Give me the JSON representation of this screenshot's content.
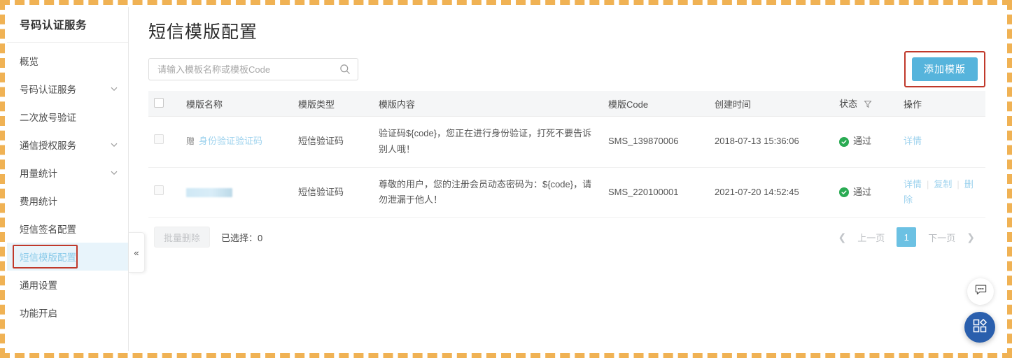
{
  "sidebar": {
    "title": "号码认证服务",
    "items": [
      {
        "label": "概览",
        "expandable": false,
        "active": false
      },
      {
        "label": "号码认证服务",
        "expandable": true,
        "active": false
      },
      {
        "label": "二次放号验证",
        "expandable": false,
        "active": false
      },
      {
        "label": "通信授权服务",
        "expandable": true,
        "active": false
      },
      {
        "label": "用量统计",
        "expandable": true,
        "active": false
      },
      {
        "label": "费用统计",
        "expandable": false,
        "active": false
      },
      {
        "label": "短信签名配置",
        "expandable": false,
        "active": false
      },
      {
        "label": "短信模版配置",
        "expandable": false,
        "active": true
      },
      {
        "label": "通用设置",
        "expandable": false,
        "active": false
      },
      {
        "label": "功能开启",
        "expandable": false,
        "active": false
      }
    ],
    "collapse_icon": "«"
  },
  "main": {
    "page_title": "短信模版配置",
    "search": {
      "value": "",
      "placeholder": "请输入模板名称或模板Code",
      "icon": "search-icon"
    },
    "add_button": {
      "label": "添加模版",
      "color": "#56b4dc"
    },
    "table": {
      "columns": [
        "",
        "模版名称",
        "模版类型",
        "模版内容",
        "模版Code",
        "创建时间",
        "状态",
        "操作"
      ],
      "status_filter_icon": "filter-icon",
      "rows": [
        {
          "checked": false,
          "tag": "赠",
          "name": "身份验证验证码",
          "name_redacted": false,
          "type": "短信验证码",
          "content": "验证码${code}，您正在进行身份验证，打死不要告诉别人哦！",
          "code": "SMS_139870006",
          "created_at": "2018-07-13 15:36:06",
          "status": "通过",
          "actions": [
            "详情"
          ]
        },
        {
          "checked": false,
          "tag": "",
          "name": "",
          "name_redacted": true,
          "type": "短信验证码",
          "content": "尊敬的用户，您的注册会员动态密码为：${code}，请勿泄漏于他人！",
          "code": "SMS_220100001",
          "created_at": "2021-07-20 14:52:45",
          "status": "通过",
          "actions": [
            "详情",
            "复制",
            "删除"
          ]
        }
      ]
    },
    "footer": {
      "bulk_delete_label": "批量删除",
      "selected_label": "已选择：",
      "selected_count": "0",
      "pagination": {
        "prev_arrow": "❮",
        "prev_label": "上一页",
        "current_page": "1",
        "next_label": "下一页",
        "next_arrow": "❯"
      }
    },
    "fabs": [
      {
        "name": "chat-bubble-icon"
      },
      {
        "name": "apps-grid-icon"
      }
    ]
  },
  "colors": {
    "accent": "#56b4dc",
    "link": "#9fd3ee",
    "status_ok": "#2aab53",
    "annotation": "#c0392b",
    "frame": "#f0b254"
  }
}
